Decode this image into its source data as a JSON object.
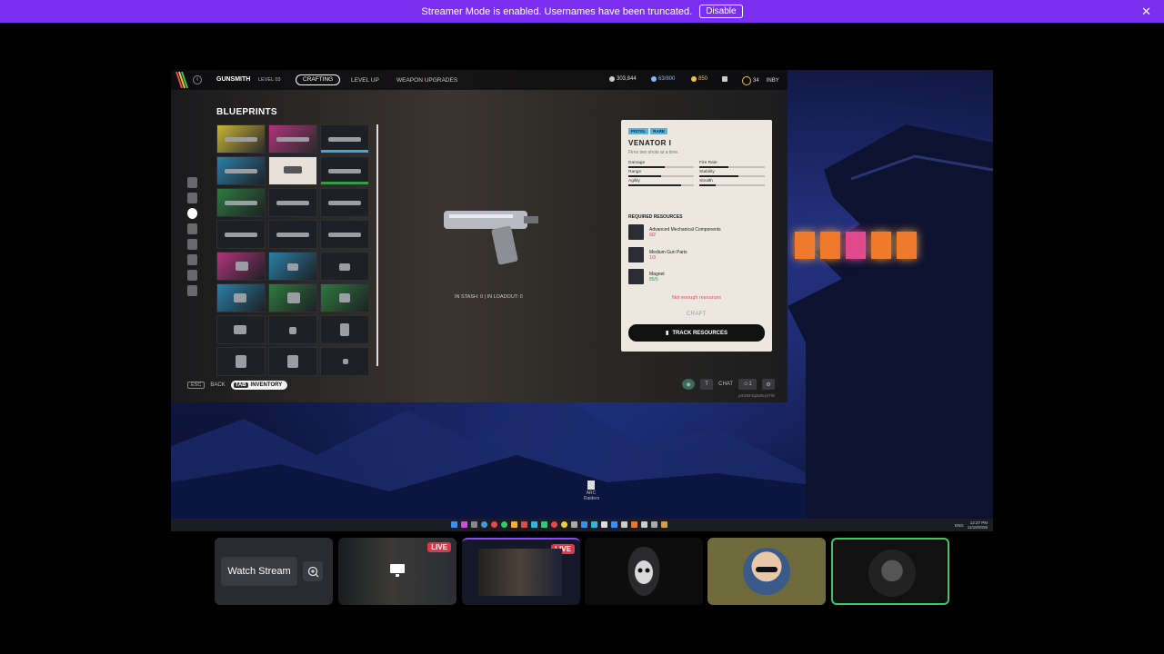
{
  "banner": {
    "text": "Streamer Mode is enabled. Usernames have been truncated.",
    "disable_label": "Disable",
    "close_glyph": "✕"
  },
  "game": {
    "title": "GUNSMITH",
    "level": "LEVEL 03",
    "tabs": [
      "CRAFTING",
      "LEVEL UP",
      "WEAPON UPGRADES"
    ],
    "currency": {
      "coins": "303,844",
      "capacity": "63/800",
      "credits": "850",
      "level_badge": "34",
      "user": "INBY"
    },
    "section_title": "BLUEPRINTS",
    "stash": "IN STASH: 0  |  IN LOADOUT: 0",
    "panel": {
      "tags": [
        "PISTOL",
        "RARE"
      ],
      "name": "VENATOR I",
      "desc": "Fires two shots at a time.",
      "stats": [
        {
          "label": "Damage",
          "value": 0.55
        },
        {
          "label": "Fire Rate",
          "value": 0.45
        },
        {
          "label": "Range",
          "value": 0.5
        },
        {
          "label": "Stability",
          "value": 0.6
        },
        {
          "label": "Agility",
          "value": 0.8
        },
        {
          "label": "Stealth",
          "value": 0.25
        }
      ],
      "required_title": "REQUIRED RESOURCES",
      "resources": [
        {
          "name": "Advanced Mechanical Components",
          "count": "0/2"
        },
        {
          "name": "Medium Gun Parts",
          "count": "1/3"
        },
        {
          "name": "Magnet",
          "count": "85/5"
        }
      ],
      "warning": "Not enough resources",
      "craft_label": "CRAFT",
      "track_label": "TRACK RESOURCES"
    },
    "bottom": {
      "esc": "ESC",
      "back": "BACK",
      "tab": "TAB",
      "inventory": "INVENTORY",
      "t_key": "T",
      "chat": "CHAT",
      "party_count": "1",
      "session_id": "p3183-lq2w5-j47rb"
    }
  },
  "desktop": {
    "icon_label": "ARC Raiders"
  },
  "taskbar": {
    "time": "12:27 PM",
    "date": "11/18/2025",
    "lang": "ENG"
  },
  "strip": {
    "watch_label": "Watch Stream",
    "live_label": "LIVE"
  },
  "colors": {
    "banner": "#7b2ff0",
    "live": "#e0384b",
    "speaking": "#45c265"
  }
}
